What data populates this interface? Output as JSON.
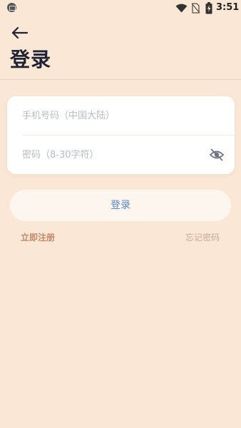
{
  "status_bar": {
    "time": "3:51",
    "icons": [
      "app-notification-icon",
      "wifi-icon",
      "no-sim-icon",
      "battery-charging-icon"
    ]
  },
  "header": {
    "back_icon": "arrow-left-icon",
    "title": "登录"
  },
  "form": {
    "phone_placeholder": "手机号码（中国大陆）",
    "phone_value": "",
    "password_placeholder": "密码（8-30字符）",
    "password_value": "",
    "password_visibility_icon": "eye-off-icon"
  },
  "actions": {
    "login_label": "登录",
    "register_label": "立即注册",
    "forgot_label": "忘记密码"
  },
  "colors": {
    "background": "#FAE7D5",
    "card": "#FFFFFF",
    "title": "#1E2333",
    "login_text": "#5A86C6",
    "register_text": "#C08A67",
    "forgot_text": "#C7A995"
  }
}
